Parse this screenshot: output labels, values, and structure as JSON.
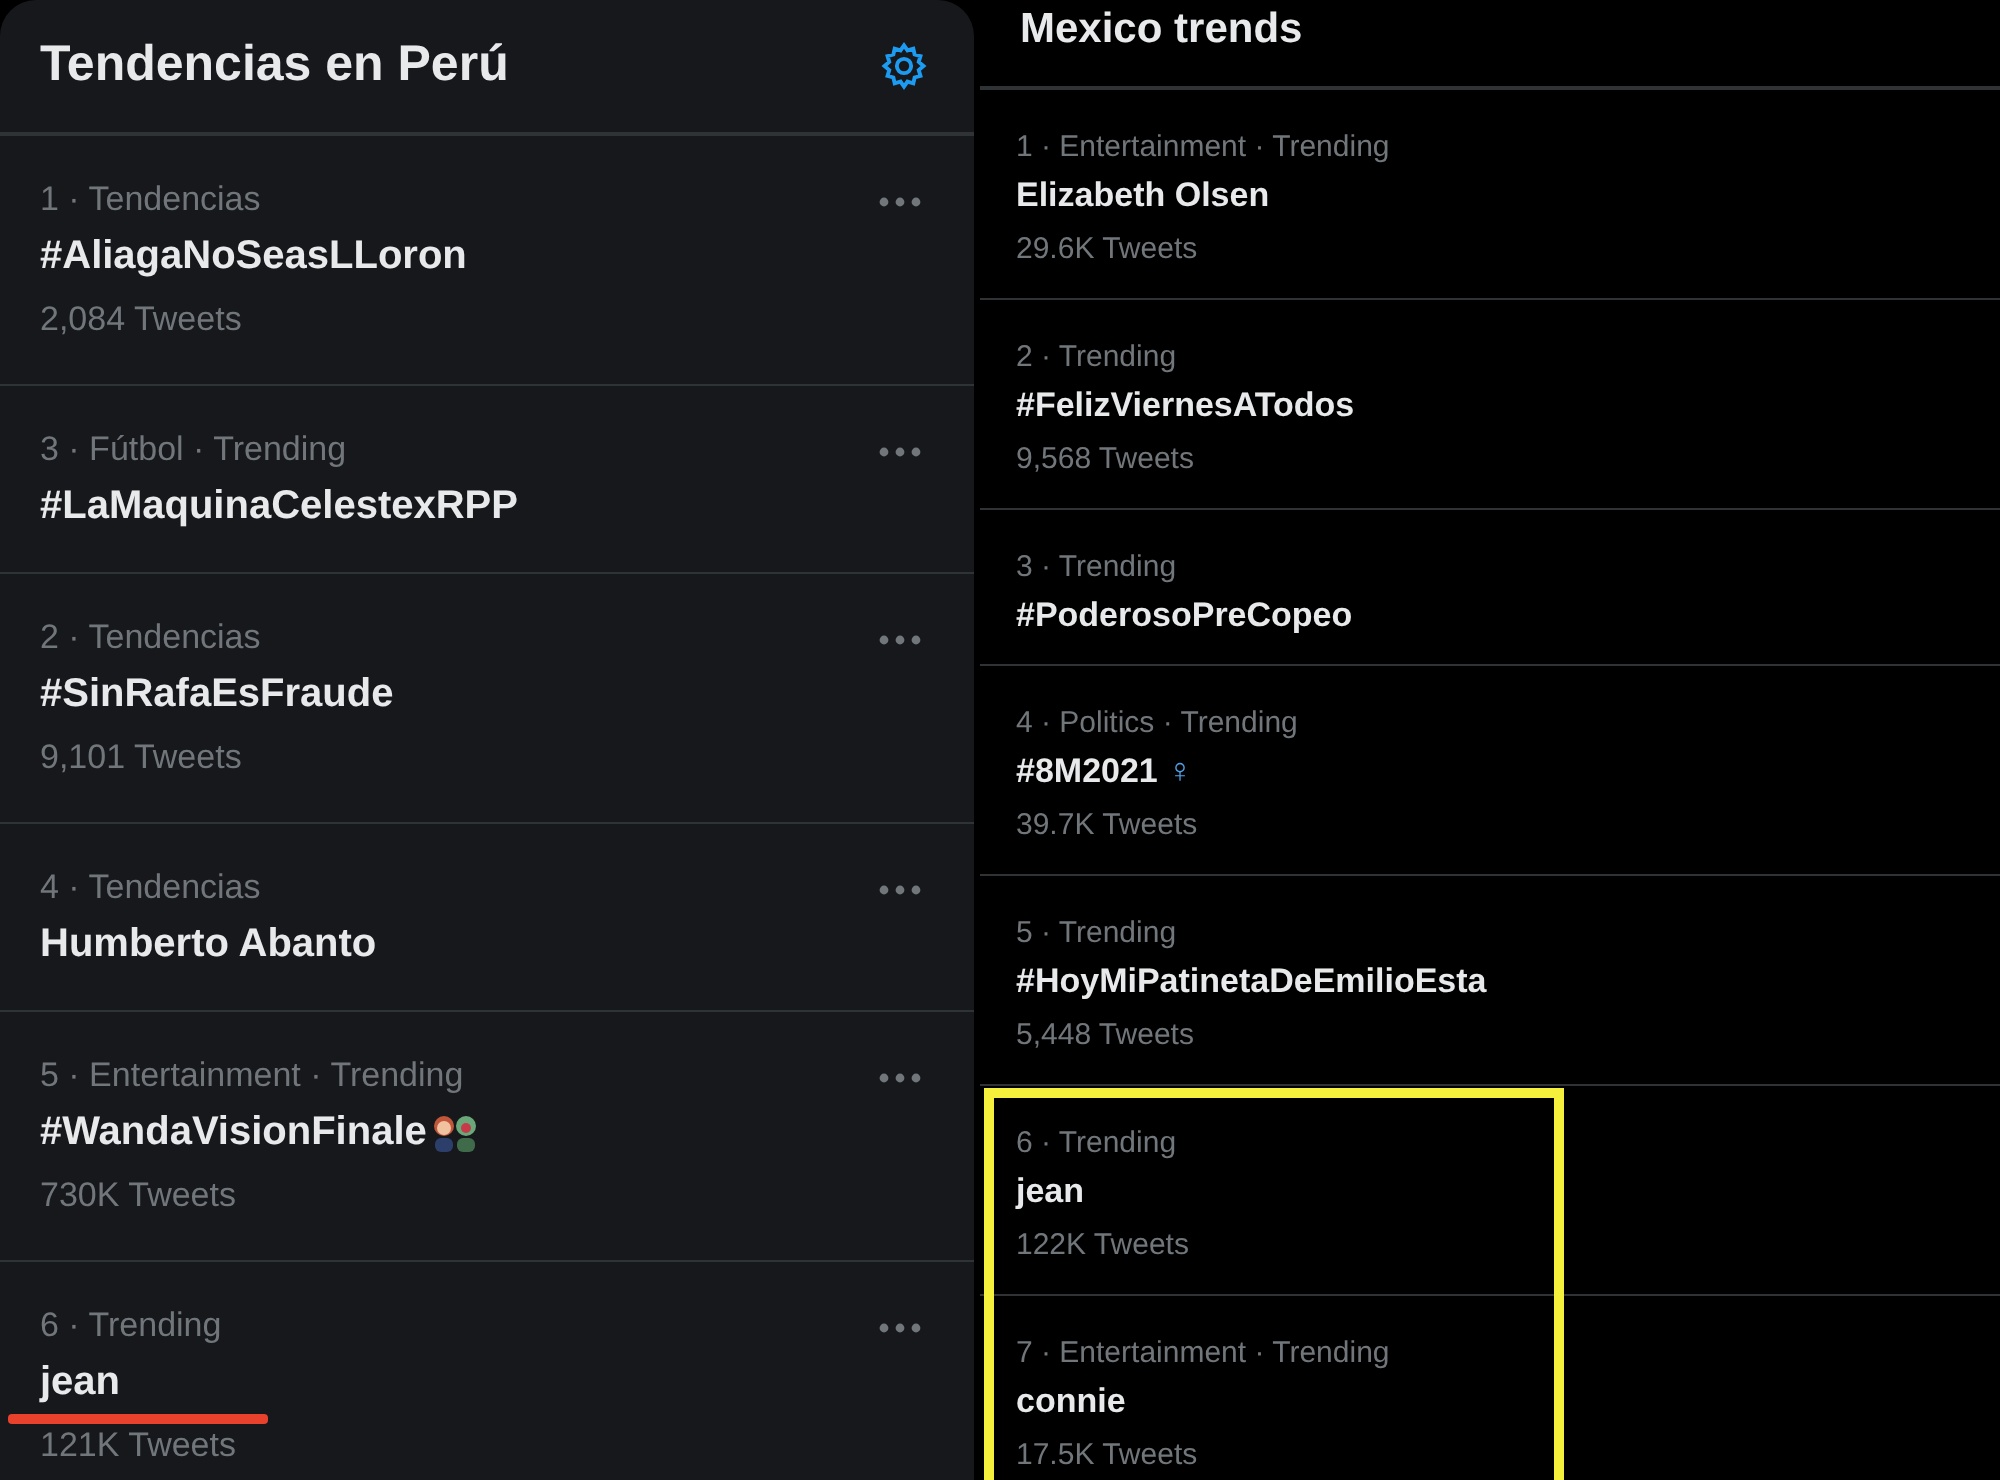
{
  "left_panel": {
    "title": "Tendencias en Perú",
    "trends": [
      {
        "meta": "1 · Tendencias",
        "name": "#AliagaNoSeasLLoron",
        "count": "2,084 Tweets",
        "underlined": false
      },
      {
        "meta": "3 · Fútbol · Trending",
        "name": "#LaMaquinaCelestexRPP",
        "underlined": false
      },
      {
        "meta": "2 · Tendencias",
        "name": "#SinRafaEsFraude",
        "count": "9,101 Tweets",
        "underlined": false
      },
      {
        "meta": "4 · Tendencias",
        "name": "Humberto Abanto",
        "underlined": false
      },
      {
        "meta": "5 · Entertainment · Trending",
        "name": "#WandaVisionFinale",
        "has_emoji": true,
        "count": "730K Tweets",
        "underlined": false
      },
      {
        "meta": "6 · Trending",
        "name": "jean",
        "count": "121K Tweets",
        "underlined": true
      }
    ]
  },
  "right_panel": {
    "title": "Mexico trends",
    "trends": [
      {
        "meta": "1 · Entertainment · Trending",
        "name": "Elizabeth Olsen",
        "count": "29.6K Tweets",
        "highlighted": false
      },
      {
        "meta": "2 · Trending",
        "name": "#FelizViernesATodos",
        "count": "9,568 Tweets",
        "highlighted": false
      },
      {
        "meta": "3 · Trending",
        "name": "#PoderosoPreCopeo",
        "highlighted": false
      },
      {
        "meta": "4 · Politics · Trending",
        "name": "#8M2021",
        "symbol": "♀",
        "count": "39.7K Tweets",
        "highlighted": false
      },
      {
        "meta": "5 · Trending",
        "name": "#HoyMiPatinetaDeEmilioEsta",
        "count": "5,448 Tweets",
        "highlighted": false
      },
      {
        "meta": "6 · Trending",
        "name": "jean",
        "count": "122K Tweets",
        "highlighted": true
      },
      {
        "meta": "7 · Entertainment · Trending",
        "name": "connie",
        "count": "17.5K Tweets",
        "highlighted": true
      }
    ]
  }
}
